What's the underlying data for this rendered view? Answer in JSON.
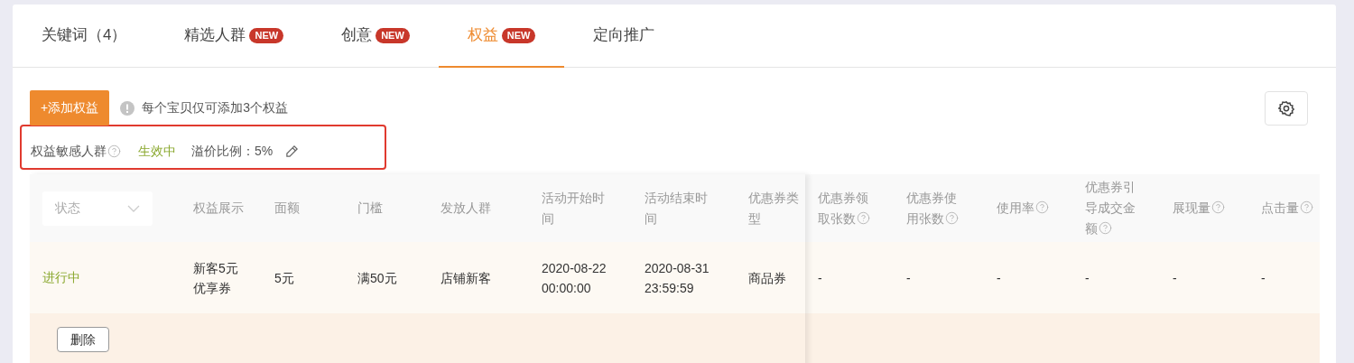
{
  "tabs": [
    {
      "label": "关键词（4）",
      "selected": false
    },
    {
      "label": "精选人群",
      "badge": "NEW",
      "selected": false
    },
    {
      "label": "创意",
      "badge": "NEW",
      "selected": false
    },
    {
      "label": "权益",
      "badge": "NEW",
      "selected": true
    },
    {
      "label": "定向推广",
      "selected": false
    }
  ],
  "toolbar": {
    "add_button": "+添加权益",
    "hint": "每个宝贝仅可添加3个权益"
  },
  "sensitive_bar": {
    "label": "权益敏感人群",
    "status": "生效中",
    "premium": "溢价比例：5%"
  },
  "table": {
    "status_filter": {
      "placeholder": "状态"
    },
    "columns": [
      {
        "label": "权益展示",
        "help": false
      },
      {
        "label": "面额",
        "help": false
      },
      {
        "label": "门槛",
        "help": false
      },
      {
        "label": "发放人群",
        "help": false
      },
      {
        "label": "活动开始时间",
        "help": false
      },
      {
        "label": "活动结束时间",
        "help": false
      },
      {
        "label": "优惠券类型",
        "help": false
      },
      {
        "label": "优惠券领取张数",
        "help": true
      },
      {
        "label": "优惠券使用张数",
        "help": true
      },
      {
        "label": "使用率",
        "help": true
      },
      {
        "label": "优惠券引导成交金额",
        "help": true
      },
      {
        "label": "展现量",
        "help": true
      },
      {
        "label": "点击量",
        "help": true
      }
    ],
    "rows": [
      {
        "status": "进行中",
        "cells": [
          "新客5元优享券",
          "5元",
          "满50元",
          "店铺新客",
          "2020-08-22 00:00:00",
          "2020-08-31 23:59:59",
          "商品券",
          "-",
          "-",
          "-",
          "-",
          "-",
          "-"
        ],
        "action": "删除"
      }
    ]
  }
}
